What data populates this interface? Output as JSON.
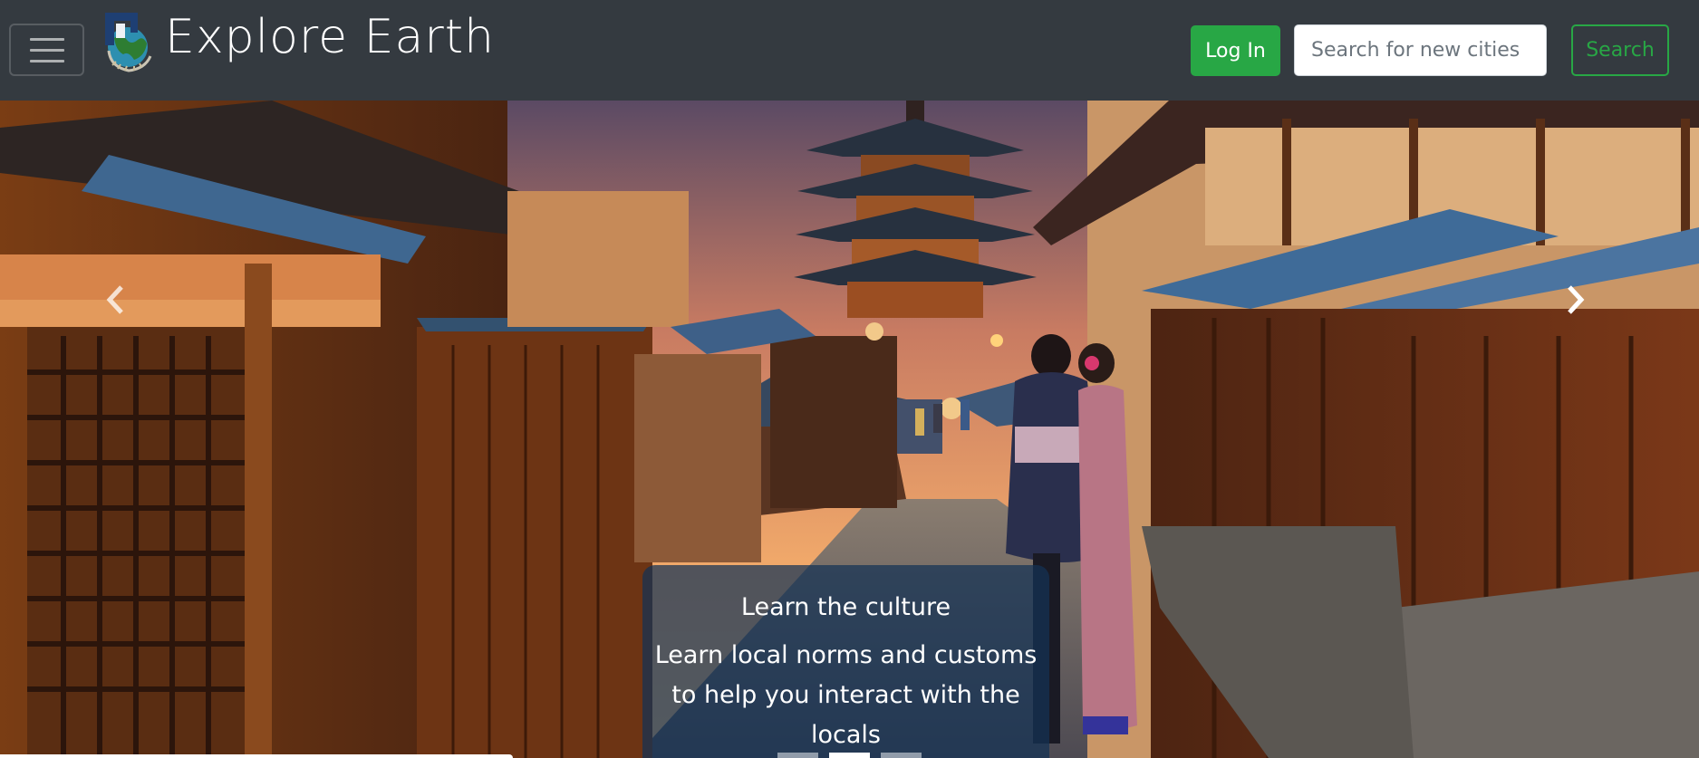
{
  "navbar": {
    "brand": "Explore Earth",
    "login_label": "Log In",
    "search_placeholder": "Search for new cities",
    "search_value": "",
    "search_label": "Search",
    "toggler_icon": "hamburger-menu-icon",
    "logo_icon": "globe-logo-icon"
  },
  "carousel": {
    "slide_count": 3,
    "active_slide": 1,
    "prev_icon": "chevron-left-icon",
    "next_icon": "chevron-right-icon",
    "caption": {
      "title": "Learn the culture",
      "text": "Learn local norms and customs to help you interact with the locals"
    }
  },
  "colors": {
    "navbar_bg": "#343a40",
    "success": "#28a745",
    "caption_bg": "rgba(20,50,85,0.72)"
  }
}
